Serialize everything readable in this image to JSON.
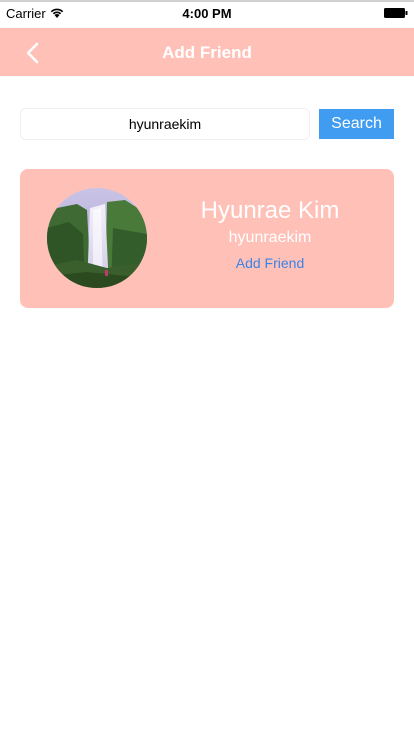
{
  "status_bar": {
    "carrier": "Carrier",
    "time": "4:00 PM",
    "wifi_icon": "wifi-icon",
    "battery_icon": "battery-icon"
  },
  "nav": {
    "title": "Add Friend",
    "back_icon": "chevron-left-icon"
  },
  "search": {
    "value": "hyunraekim",
    "button_label": "Search"
  },
  "result": {
    "name": "Hyunrae Kim",
    "username": "hyunraekim",
    "action_label": "Add Friend",
    "avatar_image": "waterfall-photo"
  },
  "colors": {
    "nav_background": "#ffc0b8",
    "card_background": "#ffc0b8",
    "search_button": "#3f9cf0",
    "link": "#3a84e8"
  }
}
